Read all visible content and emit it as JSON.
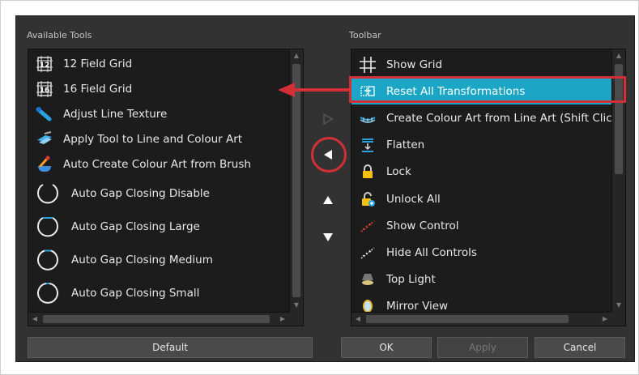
{
  "available_tools": {
    "label": "Available Tools",
    "items": [
      {
        "label": "12 Field Grid",
        "icon": "grid-12-icon"
      },
      {
        "label": "16 Field Grid",
        "icon": "grid-16-icon"
      },
      {
        "label": "Adjust Line Texture",
        "icon": "brush-line-icon"
      },
      {
        "label": "Apply Tool to Line and Colour Art",
        "icon": "layers-icon"
      },
      {
        "label": "Auto Create Colour Art from Brush",
        "icon": "brush-bucket-icon"
      },
      {
        "label": "Auto Gap Closing Disable",
        "icon": "gap-circle-icon"
      },
      {
        "label": "Auto Gap Closing Large",
        "icon": "gap-circle-large-icon"
      },
      {
        "label": "Auto Gap Closing Medium",
        "icon": "gap-circle-medium-icon"
      },
      {
        "label": "Auto Gap Closing Small",
        "icon": "gap-circle-small-icon"
      }
    ]
  },
  "toolbar": {
    "label": "Toolbar",
    "items": [
      {
        "label": "Show Grid",
        "icon": "grid-icon"
      },
      {
        "label": "Reset All Transformations",
        "icon": "reset-transform-icon",
        "selected": true
      },
      {
        "label": "Create Colour Art from Line Art (Shift Clic",
        "icon": "create-colour-art-icon"
      },
      {
        "label": "Flatten",
        "icon": "flatten-icon"
      },
      {
        "label": "Lock",
        "icon": "lock-icon"
      },
      {
        "label": "Unlock All",
        "icon": "unlock-icon"
      },
      {
        "label": "Show Control",
        "icon": "show-control-icon"
      },
      {
        "label": "Hide All Controls",
        "icon": "hide-controls-icon"
      },
      {
        "label": "Top Light",
        "icon": "top-light-icon"
      },
      {
        "label": "Mirror View",
        "icon": "mirror-icon"
      }
    ]
  },
  "buttons": {
    "default": "Default",
    "ok": "OK",
    "apply": "Apply",
    "cancel": "Cancel"
  },
  "colors": {
    "selection": "#1aa6c4",
    "annotation": "#d32f36",
    "dialog_bg": "#323232",
    "list_bg": "#1c1c1c"
  }
}
